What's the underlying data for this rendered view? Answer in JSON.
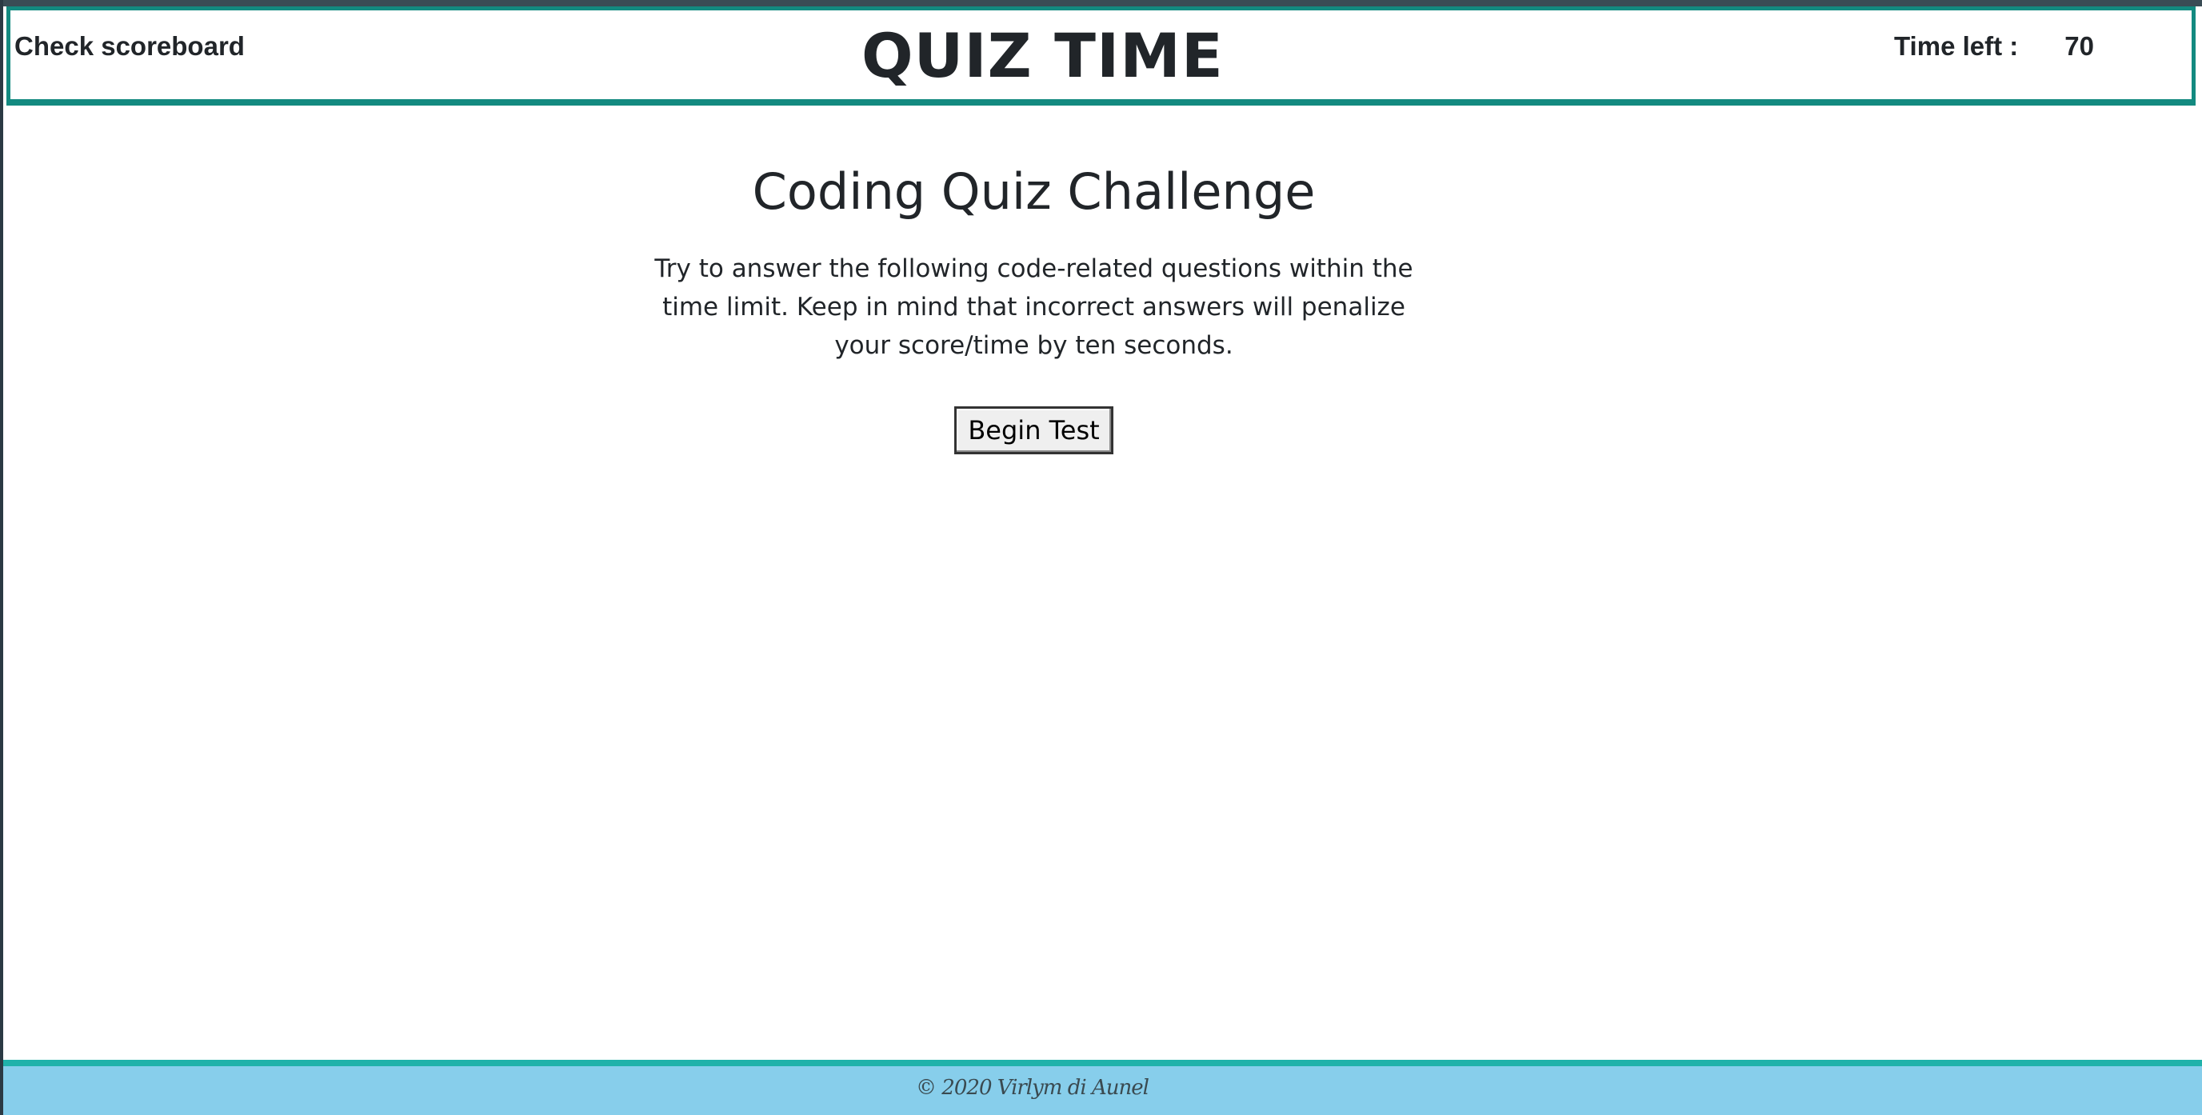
{
  "header": {
    "scoreboard_link": "Check scoreboard",
    "title": "QUIZ TIME",
    "timer_label": "Time left :",
    "timer_value": "70"
  },
  "main": {
    "heading": "Coding Quiz Challenge",
    "intro": "Try to answer the following code-related questions within the time limit. Keep in mind that incorrect answers will penalize your score/time by ten seconds.",
    "begin_button": "Begin Test"
  },
  "footer": {
    "text": "© 2020 Virlym di Aunel"
  },
  "colors": {
    "header_border": "#138a80",
    "footer_background": "#87ceeb",
    "footer_border": "#20b2aa"
  }
}
